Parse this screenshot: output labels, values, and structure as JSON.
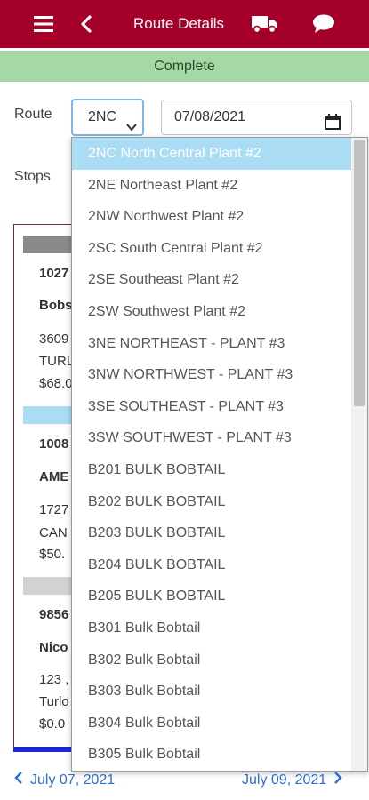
{
  "header": {
    "title": "Route Details",
    "icons": [
      "hamburger-menu-icon",
      "back-chevron-icon",
      "truck-icon",
      "chat-bubble-icon"
    ],
    "background_color": "#a5002a"
  },
  "status": {
    "text": "Complete",
    "color": "#a6d8a6"
  },
  "form": {
    "route_label": "Route",
    "route_value": "2NC",
    "date_value": "07/08/2021",
    "stops_label": "Stops"
  },
  "dropdown": {
    "options": [
      "2NC North Central Plant #2",
      "2NE Northeast Plant #2",
      "2NW Northwest Plant #2",
      "2SC South Central Plant #2",
      "2SE Southeast Plant #2",
      "2SW Southwest Plant #2",
      "3NE NORTHEAST - PLANT #3",
      "3NW NORTHWEST - PLANT #3",
      "3SE SOUTHEAST - PLANT #3",
      "3SW SOUTHWEST - PLANT #3",
      "B201 BULK BOBTAIL",
      "B202 BULK BOBTAIL",
      "B203 BULK BOBTAIL",
      "B204 BULK BOBTAIL",
      "B205 BULK BOBTAIL",
      "B301 Bulk Bobtail",
      "B302 Bulk Bobtail",
      "B303 Bulk Bobtail",
      "B304 Bulk Bobtail",
      "B305 Bulk Bobtail"
    ],
    "selected_index": 0,
    "selected_color": "#aadcf4"
  },
  "cards": [
    {
      "id": "1027",
      "name": "Bobs",
      "addr1": "3609",
      "addr2": "TURL",
      "amount": "$68.0",
      "strip_color": "#8a8a8a"
    },
    {
      "id": "1008",
      "name": "AME",
      "addr1": "1727",
      "addr2": "CAN",
      "amount": "$50.",
      "strip_color": "#aadcf4"
    },
    {
      "id": "9856",
      "name": "Nico",
      "addr1": "123 ,",
      "addr2": "Turlo",
      "amount": "$0.0",
      "strip_color": "#d2d2d2"
    }
  ],
  "footer": {
    "prev_label": "July 07, 2021",
    "next_label": "July 09, 2021",
    "link_color": "#2a6fd6"
  }
}
